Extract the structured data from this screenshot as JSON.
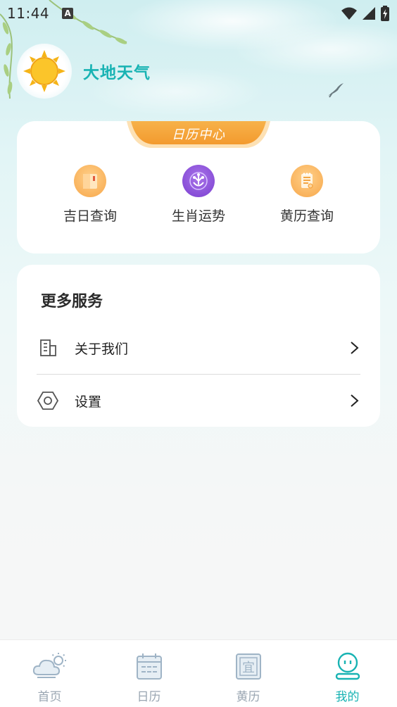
{
  "status_bar": {
    "time": "11:44",
    "notification_icon": "A"
  },
  "header": {
    "app_title": "大地天气",
    "logo_icon": "sun-icon"
  },
  "calendar_center": {
    "banner_label": "日历中心",
    "features": [
      {
        "label": "吉日查询",
        "icon": "book-icon"
      },
      {
        "label": "生肖运势",
        "icon": "zodiac-icon"
      },
      {
        "label": "黄历查询",
        "icon": "almanac-icon"
      }
    ]
  },
  "more_services": {
    "title": "更多服务",
    "items": [
      {
        "label": "关于我们",
        "icon": "building-icon"
      },
      {
        "label": "设置",
        "icon": "settings-hex-icon"
      }
    ]
  },
  "tabbar": {
    "tabs": [
      {
        "label": "首页",
        "icon": "weather-icon"
      },
      {
        "label": "日历",
        "icon": "calendar-icon"
      },
      {
        "label": "黄历",
        "icon": "almanac-tab-icon"
      },
      {
        "label": "我的",
        "icon": "profile-icon"
      }
    ],
    "active_index": 3
  },
  "colors": {
    "accent": "#18b3b3",
    "banner_orange": "#f6a53a",
    "inactive": "#9aa6b2"
  }
}
